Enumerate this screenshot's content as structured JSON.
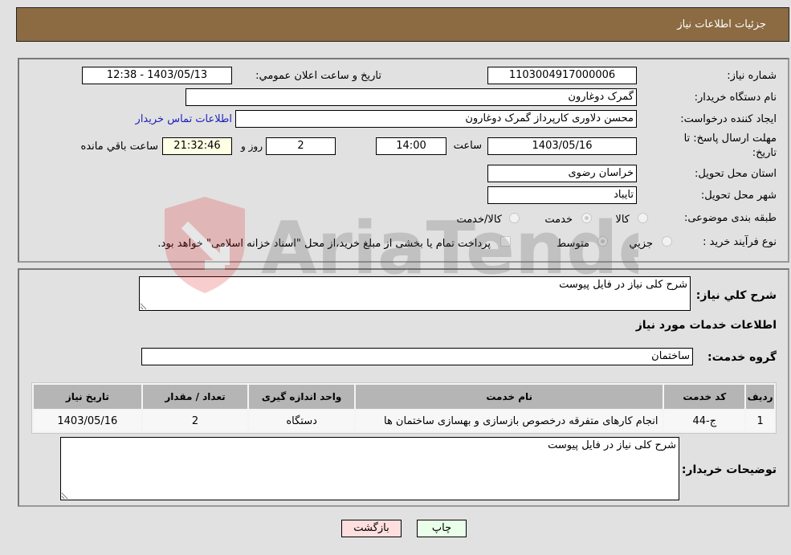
{
  "header": {
    "title": "جزئیات اطلاعات نیاز"
  },
  "form": {
    "need_number": {
      "label": "شماره نیاز:",
      "value": "1103004917000006"
    },
    "announce_datetime": {
      "label": "تاریخ و ساعت اعلان عمومي:",
      "value": "1403/05/13 - 12:38"
    },
    "buyer_org": {
      "label": "نام دستگاه خریدار:",
      "value": "گمرک دوغارون"
    },
    "requester": {
      "label": "ایجاد کننده درخواست:",
      "value": "محسن دلاوری کارپرداز گمرک دوغارون"
    },
    "buyer_contact_link": "اطلاعات تماس خریدار",
    "deadline": {
      "label_line1": "مهلت ارسال پاسخ: تا",
      "label_line2": "تاریخ:",
      "date": "1403/05/16",
      "time_label": "ساعت",
      "time": "14:00",
      "days": "2",
      "days_label": "روز و",
      "remaining": "21:32:46",
      "remaining_label": "ساعت باقي مانده"
    },
    "province": {
      "label": "استان محل تحویل:",
      "value": "خراسان رضوی"
    },
    "city": {
      "label": "شهر محل تحویل:",
      "value": "تایباد"
    },
    "category": {
      "label": "طبقه بندی موضوعی:",
      "options": [
        "کالا",
        "خدمت",
        "کالا/خدمت"
      ],
      "selected": "خدمت"
    },
    "purchase_process": {
      "label": "نوع فرآیند خرید :",
      "options": [
        "جزيي",
        "متوسط"
      ],
      "selected": "متوسط",
      "treasury_note": "پرداخت تمام یا بخشی از مبلغ خرید،از محل \"اسناد خزانه اسلامی\" خواهد بود."
    }
  },
  "details": {
    "general_desc_label": "شرح کلي نیاز:",
    "general_desc_value": "شرح کلی نیاز در فایل پیوست",
    "services_heading": "اطلاعات خدمات مورد نیاز",
    "service_group_label": "گروه خدمت:",
    "service_group_value": "ساختمان",
    "table": {
      "headers": [
        "ردیف",
        "کد خدمت",
        "نام خدمت",
        "واحد اندازه گیری",
        "تعداد / مقدار",
        "تاریخ نیاز"
      ],
      "rows": [
        [
          "1",
          "ج-44",
          "انجام کارهای متفرقه درخصوص بازسازی و بهسازی ساختمان ها",
          "دستگاه",
          "2",
          "1403/05/16"
        ]
      ]
    },
    "buyer_notes_label": "توضیحات خریدار:",
    "buyer_notes_value": "شرح کلی نیاز در فایل پیوست"
  },
  "buttons": {
    "print": "چاپ",
    "back": "بازگشت"
  },
  "watermark": "AriaTender.neT",
  "colors": {
    "header_bg": "#8c6b43",
    "print_bg": "#eaffea",
    "back_bg": "#ffdede",
    "link": "#2020c0",
    "remaining_bg": "#ffffe6"
  }
}
